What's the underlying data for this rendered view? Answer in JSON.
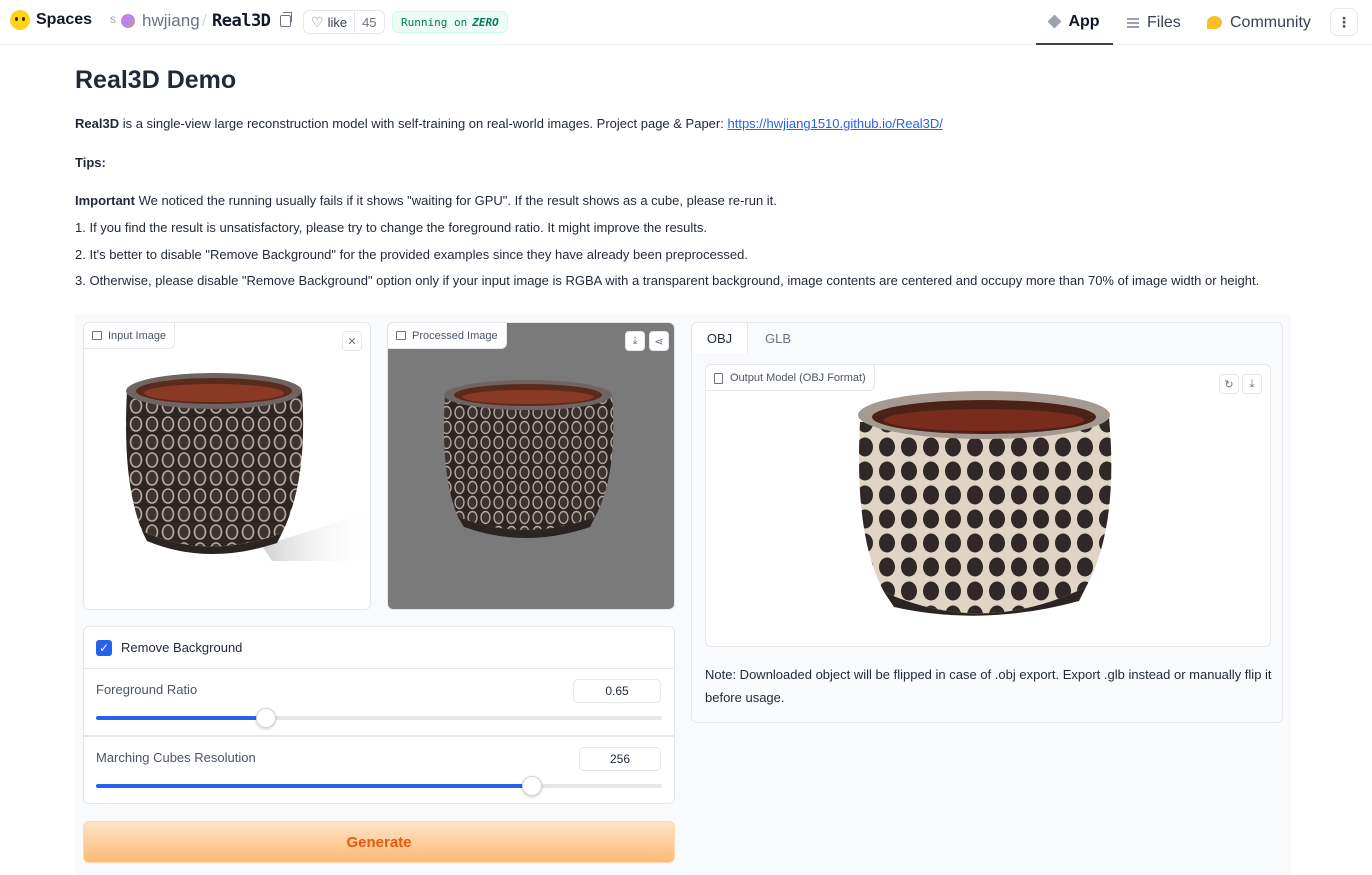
{
  "topbar": {
    "brand": "Spaces",
    "user": "hwjiang",
    "repo": "Real3D",
    "like_label": "like",
    "like_count": "45",
    "running_prefix": "Running on",
    "running_hw": "ZERO",
    "tabs": [
      {
        "label": "App"
      },
      {
        "label": "Files"
      },
      {
        "label": "Community"
      }
    ],
    "more": "⋮"
  },
  "header": {
    "title": "Real3D Demo",
    "intro_bold": "Real3D",
    "intro_text": " is a single-view large reconstruction model with self-training on real-world images. Project page & Paper: ",
    "intro_link": "https://hwjiang1510.github.io/Real3D/",
    "tips": "Tips:",
    "important_bold": "Important",
    "important_text": " We noticed the running usually fails if it shows \"waiting for GPU\". If the result shows as a cube, please re-run it.",
    "tip1": "1. If you find the result is unsatisfactory, please try to change the foreground ratio. It might improve the results.",
    "tip2": "2. It's better to disable \"Remove Background\" for the provided examples since they have already been preprocessed.",
    "tip3": "3. Otherwise, please disable \"Remove Background\" option only if your input image is RGBA with a transparent background, image contents are centered and occupy more than 70% of image width or height."
  },
  "input_image": {
    "label": "Input Image",
    "close": "✕"
  },
  "processed_image": {
    "label": "Processed Image",
    "download": "⤓",
    "share": "⋖"
  },
  "options": {
    "remove_background": {
      "label": "Remove Background",
      "checked": true,
      "check": "✓"
    },
    "foreground_ratio": {
      "label": "Foreground Ratio",
      "value": "0.65",
      "fraction": 0.3
    },
    "mc_resolution": {
      "label": "Marching Cubes Resolution",
      "value": "256",
      "fraction": 0.77
    }
  },
  "generate_label": "Generate",
  "output": {
    "tabs": [
      {
        "label": "OBJ"
      },
      {
        "label": "GLB"
      }
    ],
    "model_label": "Output Model (OBJ Format)",
    "reset": "↻",
    "download": "⤓",
    "note": "Note: Downloaded object will be flipped in case of .obj export. Export .glb instead or manually flip it before usage."
  },
  "colors": {
    "accent": "#2563eb",
    "generate_text": "#ea580c",
    "processed_bg": "#7a7a7a"
  }
}
